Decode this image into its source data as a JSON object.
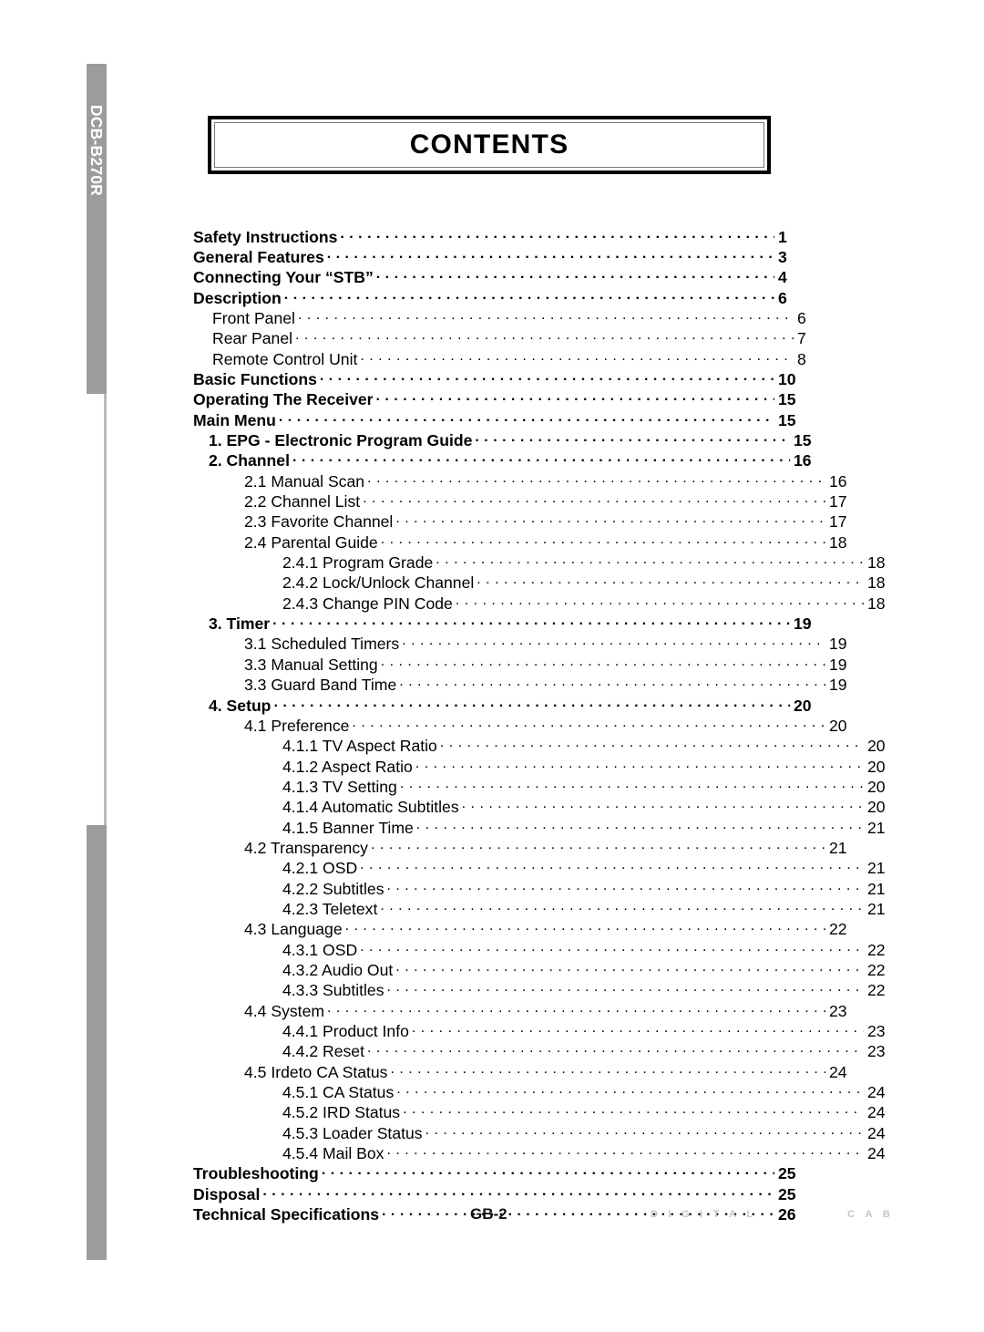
{
  "sidebar": {
    "model_label": "DCB-B270R"
  },
  "header": {
    "title": "CONTENTS"
  },
  "footer": {
    "page_label": "GB-2",
    "brand_part1": "DIGITAL",
    "brand_part2": "CAB"
  },
  "toc": {
    "entries": [
      {
        "level": "top",
        "label": "Safety Instructions",
        "page": "1"
      },
      {
        "level": "top",
        "label": "General Features",
        "page": "3"
      },
      {
        "level": "top",
        "label": "Connecting Your “STB”",
        "page": "4"
      },
      {
        "level": "top",
        "label": "Description",
        "page": "6"
      },
      {
        "level": "sub",
        "label": "Front Panel",
        "page": "6"
      },
      {
        "level": "sub",
        "label": "Rear Panel",
        "page": "7"
      },
      {
        "level": "sub",
        "label": "Remote Control Unit",
        "page": "8"
      },
      {
        "level": "top",
        "label": "Basic Functions",
        "page": "10"
      },
      {
        "level": "top",
        "label": "Operating The Receiver",
        "page": "15"
      },
      {
        "level": "top",
        "label": "Main Menu",
        "page": "15"
      },
      {
        "level": "num",
        "label": "1. EPG - Electronic Program Guide",
        "page": "15"
      },
      {
        "level": "num",
        "label": "2. Channel",
        "page": "16"
      },
      {
        "level": "l2",
        "label": "2.1  Manual Scan",
        "page": "16"
      },
      {
        "level": "l2",
        "label": "2.2  Channel List",
        "page": "17"
      },
      {
        "level": "l2",
        "label": "2.3  Favorite Channel",
        "page": "17"
      },
      {
        "level": "l2",
        "label": "2.4  Parental Guide",
        "page": "18"
      },
      {
        "level": "l3",
        "label": "2.4.1  Program Grade",
        "page": "18"
      },
      {
        "level": "l3",
        "label": "2.4.2  Lock/Unlock Channel",
        "page": "18"
      },
      {
        "level": "l3",
        "label": "2.4.3  Change PIN Code",
        "page": "18"
      },
      {
        "level": "num",
        "label": "3. Timer",
        "page": "19"
      },
      {
        "level": "l2",
        "label": "3.1  Scheduled Timers",
        "page": "19"
      },
      {
        "level": "l2",
        "label": "3.3  Manual Setting",
        "page": "19"
      },
      {
        "level": "l2",
        "label": "3.3  Guard Band Time",
        "page": "19"
      },
      {
        "level": "num",
        "label": "4. Setup",
        "page": "20"
      },
      {
        "level": "l2",
        "label": "4.1  Preference",
        "page": "20"
      },
      {
        "level": "l3",
        "label": "4.1.1 TV Aspect Ratio",
        "page": "20"
      },
      {
        "level": "l3",
        "label": "4.1.2  Aspect Ratio",
        "page": "20"
      },
      {
        "level": "l3",
        "label": "4.1.3 TV Setting",
        "page": "20"
      },
      {
        "level": "l3",
        "label": "4.1.4 Automatic Subtitles",
        "page": "20"
      },
      {
        "level": "l3",
        "label": "4.1.5 Banner Time",
        "page": "21"
      },
      {
        "level": "l2",
        "label": "4.2  Transparency",
        "page": "21"
      },
      {
        "level": "l3",
        "label": "4.2.1 OSD",
        "page": "21"
      },
      {
        "level": "l3",
        "label": "4.2.2 Subtitles",
        "page": "21"
      },
      {
        "level": "l3",
        "label": "4.2.3 Teletext",
        "page": "21"
      },
      {
        "level": "l2",
        "label": "4.3  Language",
        "page": "22"
      },
      {
        "level": "l3",
        "label": "4.3.1 OSD",
        "page": "22"
      },
      {
        "level": "l3",
        "label": "4.3.2 Audio Out",
        "page": "22"
      },
      {
        "level": "l3",
        "label": "4.3.3 Subtitles",
        "page": "22"
      },
      {
        "level": "l2",
        "label": "4.4  System",
        "page": "23"
      },
      {
        "level": "l3",
        "label": "4.4.1  Product Info",
        "page": "23"
      },
      {
        "level": "l3",
        "label": "4.4.2  Reset",
        "page": "23"
      },
      {
        "level": "l2",
        "label": "4.5  Irdeto CA Status",
        "page": "24"
      },
      {
        "level": "l3",
        "label": "4.5.1  CA Status",
        "page": "24"
      },
      {
        "level": "l3",
        "label": "4.5.2  IRD Status",
        "page": "24"
      },
      {
        "level": "l3",
        "label": "4.5.3  Loader Status",
        "page": "24"
      },
      {
        "level": "l3",
        "label": "4.5.4  Mail Box",
        "page": "24"
      },
      {
        "level": "top",
        "label": "Troubleshooting",
        "page": "25"
      },
      {
        "level": "top",
        "label": "Disposal",
        "page": "25"
      },
      {
        "level": "top",
        "label": "Technical Specifications",
        "page": "26"
      }
    ]
  }
}
